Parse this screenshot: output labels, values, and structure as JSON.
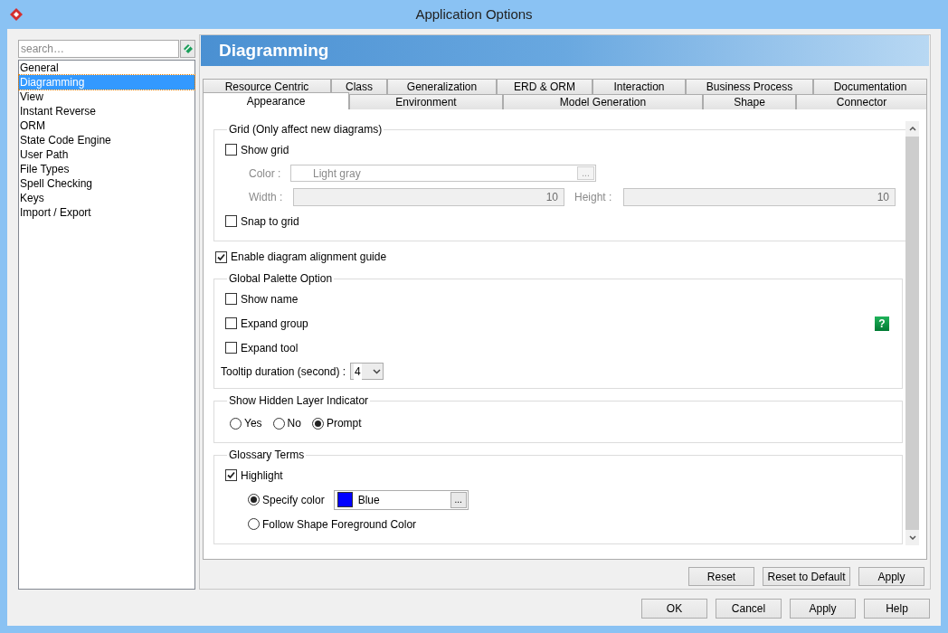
{
  "window": {
    "title": "Application Options"
  },
  "sidebar": {
    "search": {
      "placeholder": "search…"
    },
    "items": [
      {
        "label": "General",
        "selected": false
      },
      {
        "label": "Diagramming",
        "selected": true
      },
      {
        "label": "View",
        "selected": false
      },
      {
        "label": "Instant Reverse",
        "selected": false
      },
      {
        "label": "ORM",
        "selected": false
      },
      {
        "label": "State Code Engine",
        "selected": false
      },
      {
        "label": "User Path",
        "selected": false
      },
      {
        "label": "File Types",
        "selected": false
      },
      {
        "label": "Spell Checking",
        "selected": false
      },
      {
        "label": "Keys",
        "selected": false
      },
      {
        "label": "Import / Export",
        "selected": false
      }
    ]
  },
  "panel": {
    "title": "Diagramming",
    "tab_rows": [
      [
        {
          "label": "Resource Centric",
          "selected": false
        },
        {
          "label": "Class",
          "selected": false
        },
        {
          "label": "Generalization",
          "selected": false
        },
        {
          "label": "ERD & ORM",
          "selected": false
        },
        {
          "label": "Interaction",
          "selected": false
        },
        {
          "label": "Business Process",
          "selected": false
        },
        {
          "label": "Documentation",
          "selected": false
        }
      ],
      [
        {
          "label": "Appearance",
          "selected": true
        },
        {
          "label": "Environment",
          "selected": false
        },
        {
          "label": "Model Generation",
          "selected": false
        },
        {
          "label": "Shape",
          "selected": false
        },
        {
          "label": "Connector",
          "selected": false
        }
      ]
    ],
    "grid": {
      "title": "Grid (Only affect new diagrams)",
      "show_grid": {
        "label": "Show grid",
        "checked": false
      },
      "color": {
        "label": "Color :",
        "value": "Light gray",
        "button": "...",
        "disabled": true
      },
      "width": {
        "label": "Width :",
        "value": "10",
        "disabled": true
      },
      "height": {
        "label": "Height :",
        "value": "10",
        "disabled": true
      },
      "snap": {
        "label": "Snap to grid",
        "checked": false
      }
    },
    "alignment_guide": {
      "label": "Enable diagram alignment guide",
      "checked": true
    },
    "palette": {
      "title": "Global Palette Option",
      "options": [
        {
          "label": "Show name",
          "checked": false
        },
        {
          "label": "Expand group",
          "checked": false
        },
        {
          "label": "Expand tool",
          "checked": false
        }
      ],
      "help": "?",
      "tooltip": {
        "label": "Tooltip duration (second) :",
        "value": "4"
      }
    },
    "hidden_layer": {
      "title": "Show Hidden Layer Indicator",
      "options": [
        {
          "label": "Yes",
          "selected": false
        },
        {
          "label": "No",
          "selected": false
        },
        {
          "label": "Prompt",
          "selected": true
        }
      ]
    },
    "glossary": {
      "title": "Glossary Terms",
      "highlight": {
        "label": "Highlight",
        "checked": true
      },
      "color_options": [
        {
          "label": "Specify color",
          "selected": true
        },
        {
          "label": "Follow Shape Foreground Color",
          "selected": false
        }
      ],
      "color_value": {
        "name": "Blue",
        "color": "#0000ff",
        "button": "..."
      }
    },
    "buttons": [
      "Reset",
      "Reset to Default",
      "Apply"
    ]
  },
  "dialog_buttons": [
    "OK",
    "Cancel",
    "Apply",
    "Help"
  ]
}
